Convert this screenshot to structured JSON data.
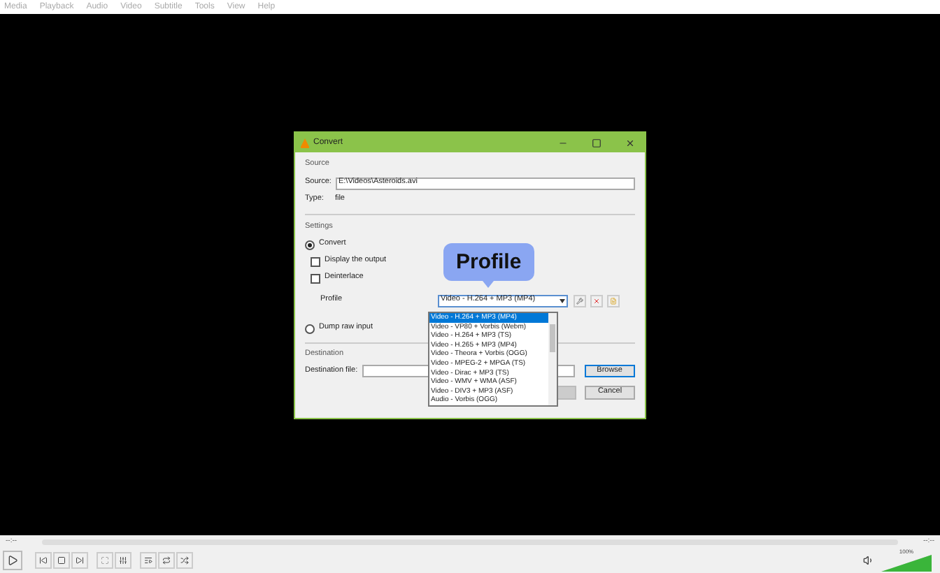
{
  "menu": [
    "Media",
    "Playback",
    "Audio",
    "Video",
    "Subtitle",
    "Tools",
    "View",
    "Help"
  ],
  "dialog": {
    "title": "Convert",
    "source": {
      "heading": "Source",
      "source_label": "Source:",
      "source_value": "E:\\Videos\\Asteroids.avi",
      "type_label": "Type:",
      "type_value": "file"
    },
    "settings": {
      "heading": "Settings",
      "options": [
        {
          "kind": "radio",
          "label": "Convert",
          "checked": true
        },
        {
          "kind": "checkbox",
          "label": "Display the output",
          "checked": false
        },
        {
          "kind": "checkbox",
          "label": "Deinterlace",
          "checked": false
        }
      ],
      "profile_label": "Profile",
      "profile_value": "Video - H.264 + MP3 (MP4)",
      "dump": {
        "label": "Dump raw input",
        "checked": false
      }
    },
    "destination": {
      "heading": "Destination",
      "file_label": "Destination file:",
      "browse": "Browse"
    },
    "start": {
      "disabled": true
    },
    "cancel": "Cancel",
    "profile_list": [
      {
        "label": "Video - H.264 + MP3 (MP4)",
        "selected": true
      },
      {
        "label": "Video - VP80 + Vorbis (Webm)",
        "selected": false
      },
      {
        "label": "Video - H.264 + MP3 (TS)",
        "selected": false
      },
      {
        "label": "Video - H.265 + MP3 (MP4)",
        "selected": false
      },
      {
        "label": "Video - Theora + Vorbis (OGG)",
        "selected": false
      },
      {
        "label": "Video - MPEG-2 + MPGA (TS)",
        "selected": false
      },
      {
        "label": "Video - Dirac + MP3 (TS)",
        "selected": false
      },
      {
        "label": "Video - WMV + WMA (ASF)",
        "selected": false
      },
      {
        "label": "Video - DIV3 + MP3 (ASF)",
        "selected": false
      },
      {
        "label": "Audio - Vorbis (OGG)",
        "selected": false
      }
    ]
  },
  "callout": "Profile",
  "player": {
    "time_elapsed": "--:--",
    "time_total": "--:--",
    "volume": {
      "label": "100%",
      "level": 1
    }
  }
}
